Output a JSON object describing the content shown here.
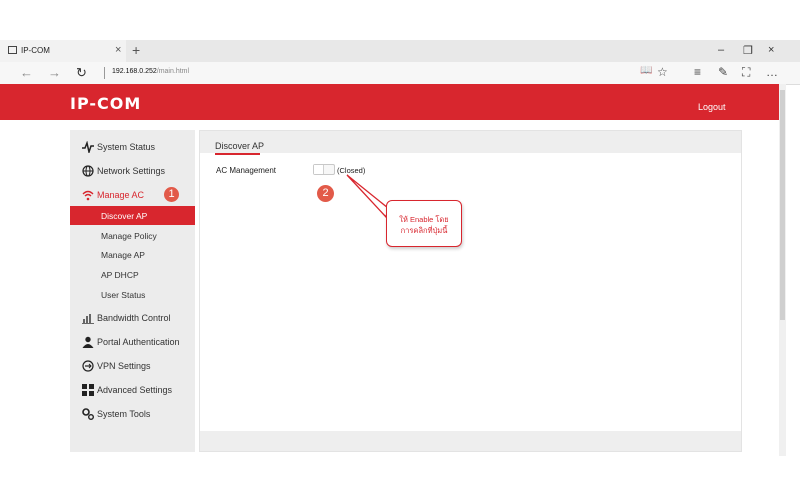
{
  "browser": {
    "tab_title": "IP-COM",
    "tab_close": "×",
    "new_tab": "+",
    "url_host": "192.168.0.252",
    "url_path": "/main.html",
    "minimize": "–",
    "restore": "❐",
    "close": "×",
    "back": "←",
    "forward": "→",
    "refresh": "↻",
    "reading_icon": "📖",
    "favorite_icon": "☆",
    "hub_icon": "≡",
    "note_icon": "✎",
    "share_icon": "⛶",
    "more_icon": "…"
  },
  "header": {
    "logo": "IP-COM",
    "logout": "Logout"
  },
  "sidebar": {
    "items": [
      {
        "label": "System Status",
        "icon": "pulse-icon"
      },
      {
        "label": "Network Settings",
        "icon": "globe-icon"
      },
      {
        "label": "Manage AC",
        "icon": "wifi-icon"
      },
      {
        "label": "Bandwidth Control",
        "icon": "bar-chart-icon"
      },
      {
        "label": "Portal Authentication",
        "icon": "user-icon"
      },
      {
        "label": "VPN Settings",
        "icon": "vpn-icon"
      },
      {
        "label": "Advanced Settings",
        "icon": "grid-icon"
      },
      {
        "label": "System Tools",
        "icon": "gears-icon"
      }
    ],
    "sub_items": [
      "Discover AP",
      "Manage Policy",
      "Manage AP",
      "AP DHCP",
      "User Status"
    ]
  },
  "main": {
    "title": "Discover AP",
    "ac_management_label": "AC Management",
    "toggle_state": "(Closed)"
  },
  "annotations": {
    "step1": "1",
    "step2": "2",
    "callout_line1": "ให้ Enable โดย",
    "callout_line2": "การคลิกที่ปุ่มนี้"
  },
  "colors": {
    "brand_red": "#d8262e",
    "badge_red": "#e25a49"
  }
}
